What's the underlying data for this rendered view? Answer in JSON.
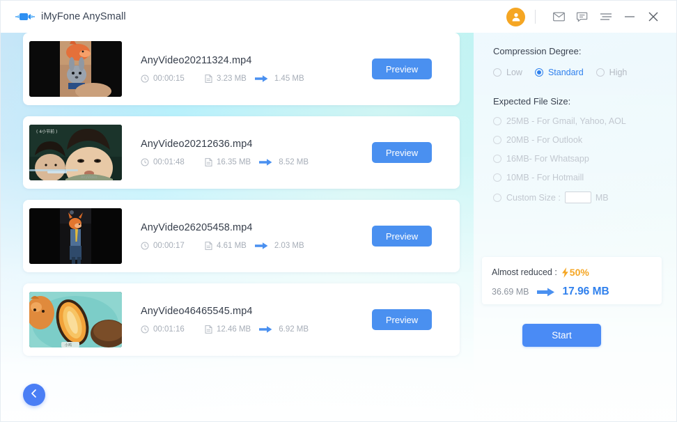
{
  "titlebar": {
    "app_name": "iMyFone AnySmall",
    "logo_icon": "video-camera-icon",
    "avatar_icon": "user-avatar-icon",
    "icons": [
      {
        "name": "mail-icon",
        "label": "Mail"
      },
      {
        "name": "feedback-icon",
        "label": "Feedback"
      },
      {
        "name": "menu-icon",
        "label": "Menu"
      },
      {
        "name": "minimize-icon",
        "label": "Minimize"
      },
      {
        "name": "close-icon",
        "label": "Close"
      }
    ]
  },
  "videos": [
    {
      "filename": "AnyVideo20211324.mp4",
      "duration": "00:00:15",
      "original_size": "3.23 MB",
      "compressed_size": "1.45 MB",
      "preview_label": "Preview"
    },
    {
      "filename": "AnyVideo20212636.mp4",
      "duration": "00:01:48",
      "original_size": "16.35 MB",
      "compressed_size": "8.52 MB",
      "preview_label": "Preview"
    },
    {
      "filename": "AnyVideo26205458.mp4",
      "duration": "00:00:17",
      "original_size": "4.61 MB",
      "compressed_size": "2.03 MB",
      "preview_label": "Preview"
    },
    {
      "filename": "AnyVideo46465545.mp4",
      "duration": "00:01:16",
      "original_size": "12.46 MB",
      "compressed_size": "6.92 MB",
      "preview_label": "Preview"
    }
  ],
  "back_button": {
    "icon": "chevron-left-icon"
  },
  "settings": {
    "compression_heading": "Compression Degree:",
    "degrees": [
      {
        "label": "Low",
        "selected": false
      },
      {
        "label": "Standard",
        "selected": true
      },
      {
        "label": "High",
        "selected": false
      }
    ],
    "size_heading": "Expected File Size:",
    "sizes": [
      {
        "label": "25MB - For Gmail, Yahoo, AOL",
        "selected": false
      },
      {
        "label": "20MB - For Outlook",
        "selected": false
      },
      {
        "label": "16MB- For Whatsapp",
        "selected": false
      },
      {
        "label": "10MB - For Hotmaill",
        "selected": false
      }
    ],
    "custom": {
      "label": "Custom Size :",
      "value": "",
      "placeholder": "",
      "unit": "MB",
      "selected": false
    }
  },
  "summary": {
    "reduced_label": "Almost reduced :",
    "bolt_icon": "lightning-bolt-icon",
    "percent": "50%",
    "size_before": "36.69 MB",
    "arrow_icon": "arrow-right-icon",
    "size_after": "17.96 MB"
  },
  "start_button": {
    "label": "Start"
  },
  "colors": {
    "accent_blue": "#4a8bf5",
    "link_blue": "#2f80ed",
    "orange": "#f5a623",
    "muted": "#b4bac3"
  }
}
